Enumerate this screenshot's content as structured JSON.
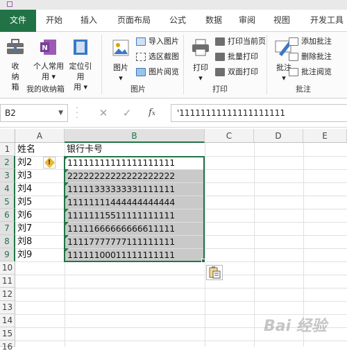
{
  "tabs": [
    "文件",
    "开始",
    "插入",
    "页面布局",
    "公式",
    "数据",
    "审阅",
    "视图",
    "开发工具"
  ],
  "ribbon": {
    "shouna": "收纳箱",
    "gerenchangyong": "个人常用",
    "dingweiyinyong": "定位引用",
    "group1_label": "我的收纳箱",
    "picture": "图片",
    "import_picture": "导入图片",
    "region_screenshot": "选区截图",
    "picture_browse": "图片阅览",
    "group2_label": "图片",
    "print": "打印",
    "print_current_page": "打印当前页",
    "batch_print": "批量打印",
    "duplex_print": "双面打印",
    "group3_label": "打印",
    "annotate": "批注",
    "add_annotation": "添加批注",
    "delete_annotation": "删除批注",
    "annotation_browse": "批注阅览",
    "group4_label": "批注"
  },
  "formula_bar": {
    "name_box": "B2",
    "formula": "'11111111111111111111"
  },
  "columns": [
    "A",
    "B",
    "C",
    "D",
    "E"
  ],
  "rows": [
    "1",
    "2",
    "3",
    "4",
    "5",
    "6",
    "7",
    "8",
    "9",
    "10",
    "11",
    "12",
    "13",
    "14",
    "15",
    "16"
  ],
  "cells": {
    "A1": "姓名",
    "B1": "银行卡号",
    "A": [
      "刘2",
      "刘3",
      "刘4",
      "刘5",
      "刘6",
      "刘7",
      "刘8",
      "刘9"
    ],
    "B": [
      "11111111111111111111",
      "22222222222222222222",
      "11111333333331111111",
      "11111111444444444444",
      "11111115511111111111",
      "11111666666666611111",
      "11117777777111111111",
      "11111100011111111111"
    ]
  },
  "watermark": "Bai 经验",
  "colors": {
    "accent": "#217346",
    "selection": "#c9c9c9"
  }
}
